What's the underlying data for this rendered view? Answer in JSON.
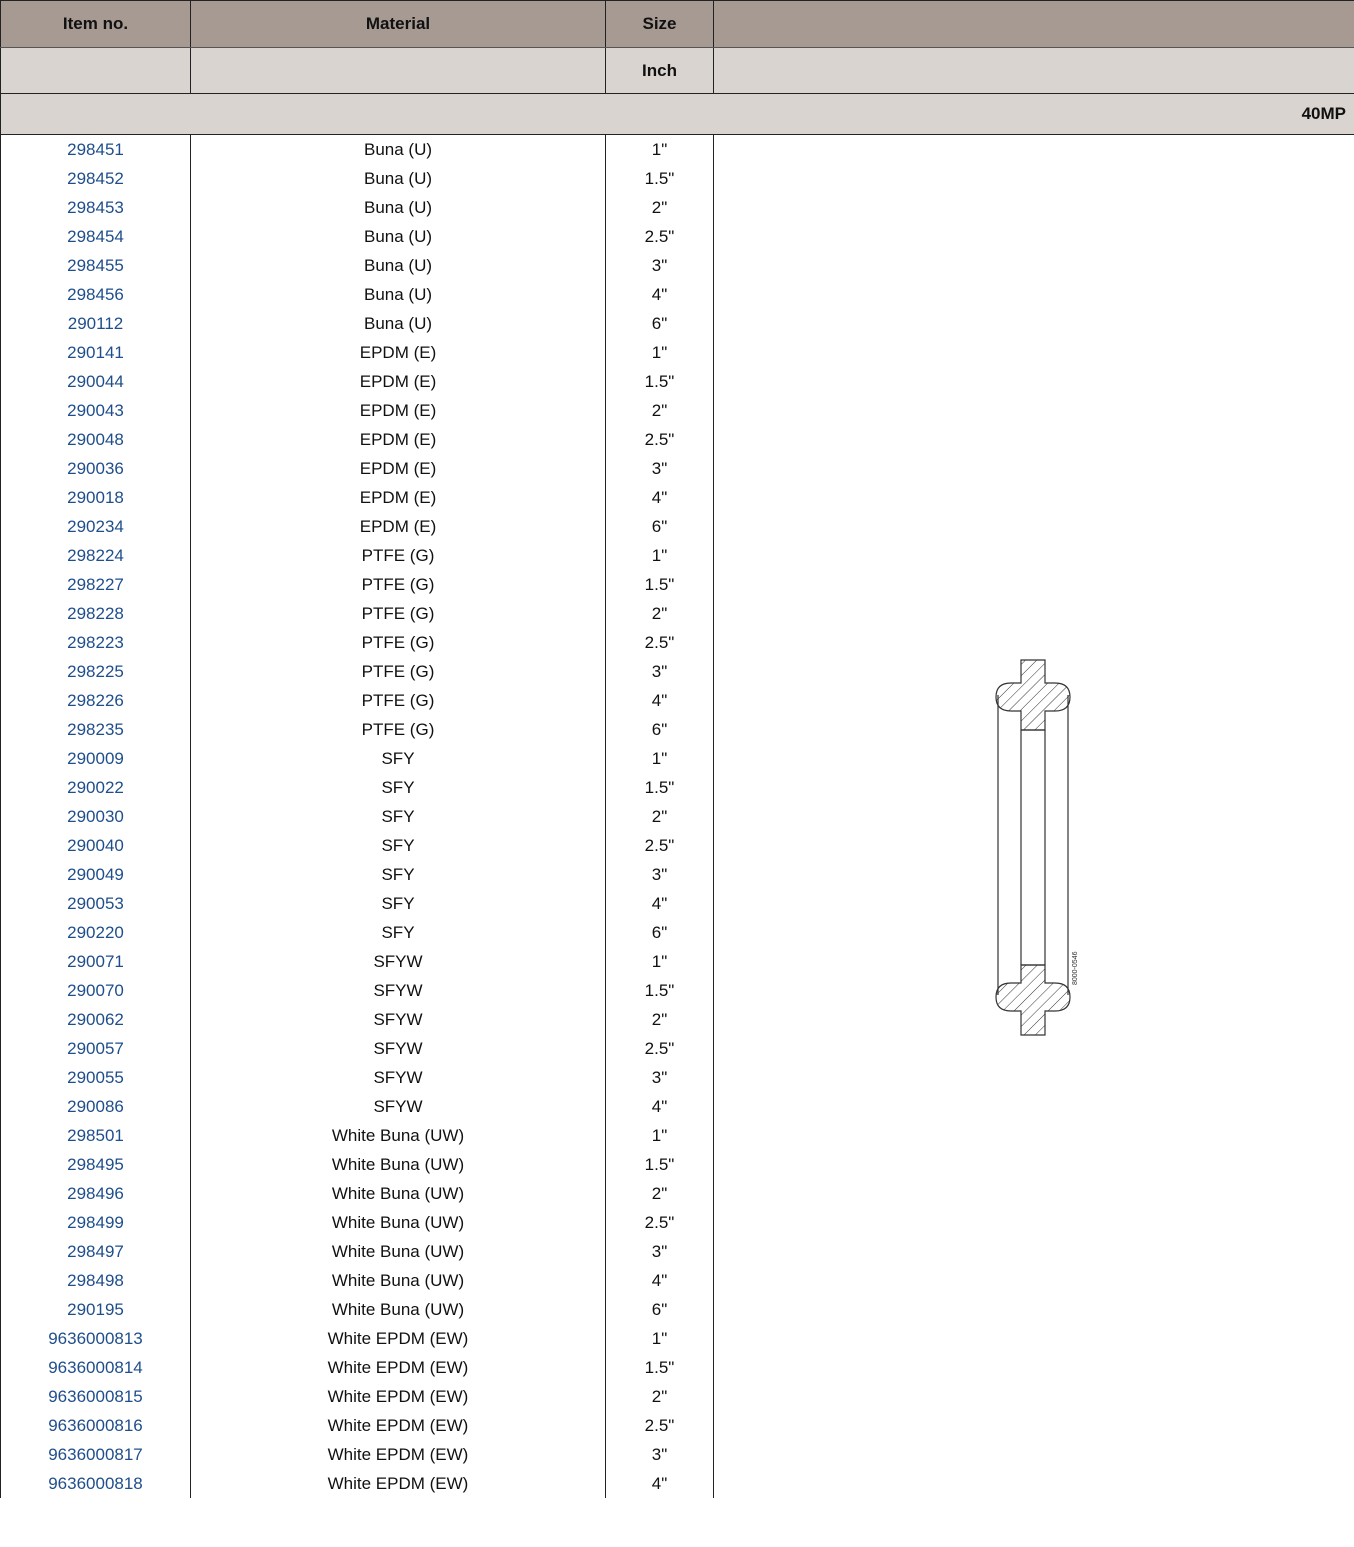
{
  "table": {
    "headers": {
      "item_no": "Item no.",
      "material": "Material",
      "size": "Size",
      "extra": ""
    },
    "subheaders": {
      "item_no": "",
      "material": "",
      "size": "Inch",
      "extra": ""
    },
    "group_label": "40MP",
    "rows": [
      {
        "item": "298451",
        "material": "Buna (U)",
        "size": "1\""
      },
      {
        "item": "298452",
        "material": "Buna (U)",
        "size": "1.5\""
      },
      {
        "item": "298453",
        "material": "Buna (U)",
        "size": "2\""
      },
      {
        "item": "298454",
        "material": "Buna (U)",
        "size": "2.5\""
      },
      {
        "item": "298455",
        "material": "Buna (U)",
        "size": "3\""
      },
      {
        "item": "298456",
        "material": "Buna (U)",
        "size": "4\""
      },
      {
        "item": "290112",
        "material": "Buna (U)",
        "size": "6\""
      },
      {
        "item": "290141",
        "material": "EPDM (E)",
        "size": "1\""
      },
      {
        "item": "290044",
        "material": "EPDM (E)",
        "size": "1.5\""
      },
      {
        "item": "290043",
        "material": "EPDM (E)",
        "size": "2\""
      },
      {
        "item": "290048",
        "material": "EPDM (E)",
        "size": "2.5\""
      },
      {
        "item": "290036",
        "material": "EPDM (E)",
        "size": "3\""
      },
      {
        "item": "290018",
        "material": "EPDM (E)",
        "size": "4\""
      },
      {
        "item": "290234",
        "material": "EPDM (E)",
        "size": "6\""
      },
      {
        "item": "298224",
        "material": "PTFE (G)",
        "size": "1\""
      },
      {
        "item": "298227",
        "material": "PTFE (G)",
        "size": "1.5\""
      },
      {
        "item": "298228",
        "material": "PTFE (G)",
        "size": "2\""
      },
      {
        "item": "298223",
        "material": "PTFE (G)",
        "size": "2.5\""
      },
      {
        "item": "298225",
        "material": "PTFE (G)",
        "size": "3\""
      },
      {
        "item": "298226",
        "material": "PTFE (G)",
        "size": "4\""
      },
      {
        "item": "298235",
        "material": "PTFE (G)",
        "size": "6\""
      },
      {
        "item": "290009",
        "material": "SFY",
        "size": "1\""
      },
      {
        "item": "290022",
        "material": "SFY",
        "size": "1.5\""
      },
      {
        "item": "290030",
        "material": "SFY",
        "size": "2\""
      },
      {
        "item": "290040",
        "material": "SFY",
        "size": "2.5\""
      },
      {
        "item": "290049",
        "material": "SFY",
        "size": "3\""
      },
      {
        "item": "290053",
        "material": "SFY",
        "size": "4\""
      },
      {
        "item": "290220",
        "material": "SFY",
        "size": "6\""
      },
      {
        "item": "290071",
        "material": "SFYW",
        "size": "1\""
      },
      {
        "item": "290070",
        "material": "SFYW",
        "size": "1.5\""
      },
      {
        "item": "290062",
        "material": "SFYW",
        "size": "2\""
      },
      {
        "item": "290057",
        "material": "SFYW",
        "size": "2.5\""
      },
      {
        "item": "290055",
        "material": "SFYW",
        "size": "3\""
      },
      {
        "item": "290086",
        "material": "SFYW",
        "size": "4\""
      },
      {
        "item": "298501",
        "material": "White Buna (UW)",
        "size": "1\""
      },
      {
        "item": "298495",
        "material": "White Buna (UW)",
        "size": "1.5\""
      },
      {
        "item": "298496",
        "material": "White Buna (UW)",
        "size": "2\""
      },
      {
        "item": "298499",
        "material": "White Buna (UW)",
        "size": "2.5\""
      },
      {
        "item": "298497",
        "material": "White Buna (UW)",
        "size": "3\""
      },
      {
        "item": "298498",
        "material": "White Buna (UW)",
        "size": "4\""
      },
      {
        "item": "290195",
        "material": "White Buna (UW)",
        "size": "6\""
      },
      {
        "item": "9636000813",
        "material": "White EPDM (EW)",
        "size": "1\""
      },
      {
        "item": "9636000814",
        "material": "White EPDM (EW)",
        "size": "1.5\""
      },
      {
        "item": "9636000815",
        "material": "White EPDM (EW)",
        "size": "2\""
      },
      {
        "item": "9636000816",
        "material": "White EPDM (EW)",
        "size": "2.5\""
      },
      {
        "item": "9636000817",
        "material": "White EPDM (EW)",
        "size": "3\""
      },
      {
        "item": "9636000818",
        "material": "White EPDM (EW)",
        "size": "4\""
      }
    ]
  },
  "drawing": {
    "label": "8000-0546",
    "icon": "gasket-cross-section-drawing"
  },
  "colors": {
    "header_bg": "#a69a93",
    "subheader_bg": "#d9d4d0",
    "link": "#1f4e8c"
  }
}
